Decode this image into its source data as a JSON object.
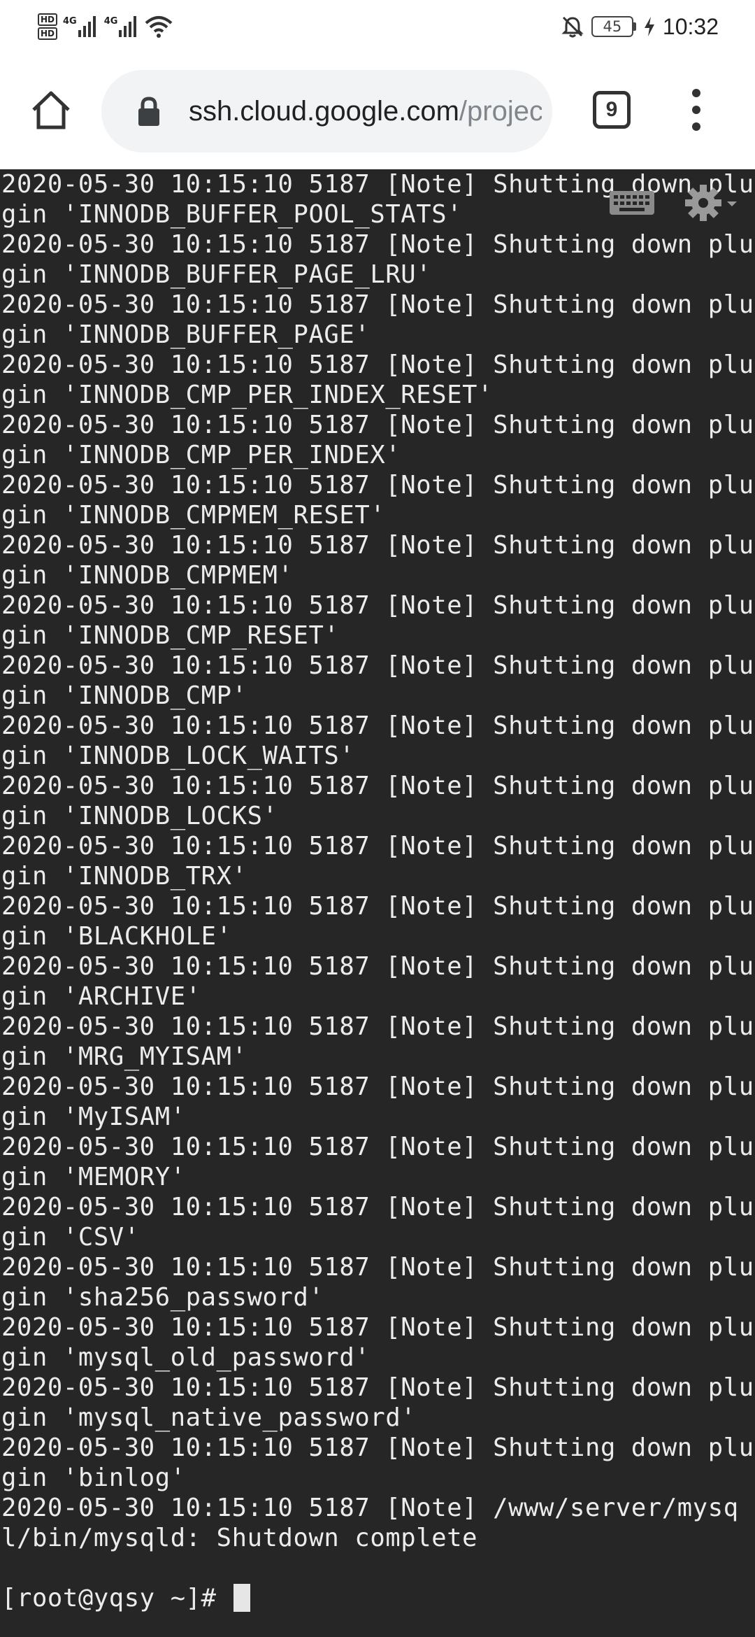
{
  "status_bar": {
    "hd_badges": [
      "HD",
      "HD"
    ],
    "network_1": "4G",
    "network_2": "4G",
    "battery": "45",
    "time": "10:32"
  },
  "toolbar": {
    "url_host": "ssh.cloud.google.com",
    "url_path": "/projects",
    "tab_count": "9"
  },
  "terminal": {
    "lines": [
      "2020-05-30 10:15:10 5187 [Note] Shutting down plugin 'INNODB_BUFFER_POOL_STATS'",
      "2020-05-30 10:15:10 5187 [Note] Shutting down plugin 'INNODB_BUFFER_PAGE_LRU'",
      "2020-05-30 10:15:10 5187 [Note] Shutting down plugin 'INNODB_BUFFER_PAGE'",
      "2020-05-30 10:15:10 5187 [Note] Shutting down plugin 'INNODB_CMP_PER_INDEX_RESET'",
      "2020-05-30 10:15:10 5187 [Note] Shutting down plugin 'INNODB_CMP_PER_INDEX'",
      "2020-05-30 10:15:10 5187 [Note] Shutting down plugin 'INNODB_CMPMEM_RESET'",
      "2020-05-30 10:15:10 5187 [Note] Shutting down plugin 'INNODB_CMPMEM'",
      "2020-05-30 10:15:10 5187 [Note] Shutting down plugin 'INNODB_CMP_RESET'",
      "2020-05-30 10:15:10 5187 [Note] Shutting down plugin 'INNODB_CMP'",
      "2020-05-30 10:15:10 5187 [Note] Shutting down plugin 'INNODB_LOCK_WAITS'",
      "2020-05-30 10:15:10 5187 [Note] Shutting down plugin 'INNODB_LOCKS'",
      "2020-05-30 10:15:10 5187 [Note] Shutting down plugin 'INNODB_TRX'",
      "2020-05-30 10:15:10 5187 [Note] Shutting down plugin 'BLACKHOLE'",
      "2020-05-30 10:15:10 5187 [Note] Shutting down plugin 'ARCHIVE'",
      "2020-05-30 10:15:10 5187 [Note] Shutting down plugin 'MRG_MYISAM'",
      "2020-05-30 10:15:10 5187 [Note] Shutting down plugin 'MyISAM'",
      "2020-05-30 10:15:10 5187 [Note] Shutting down plugin 'MEMORY'",
      "2020-05-30 10:15:10 5187 [Note] Shutting down plugin 'CSV'",
      "2020-05-30 10:15:10 5187 [Note] Shutting down plugin 'sha256_password'",
      "2020-05-30 10:15:10 5187 [Note] Shutting down plugin 'mysql_old_password'",
      "2020-05-30 10:15:10 5187 [Note] Shutting down plugin 'mysql_native_password'",
      "2020-05-30 10:15:10 5187 [Note] Shutting down plugin 'binlog'",
      "2020-05-30 10:15:10 5187 [Note] /www/server/mysql/bin/mysqld: Shutdown complete"
    ],
    "prompt": "[root@yqsy ~]# "
  },
  "colors": {
    "terminal_bg": "#262626",
    "terminal_fg": "#ececec",
    "url_bar_bg": "#f1f3f4"
  },
  "icons": [
    "hd-icon",
    "signal-icon",
    "wifi-icon",
    "bell-off-icon",
    "battery-icon",
    "charging-bolt-icon",
    "home-icon",
    "lock-icon",
    "tabs-icon",
    "more-vert-icon",
    "keyboard-icon",
    "settings-icon"
  ]
}
